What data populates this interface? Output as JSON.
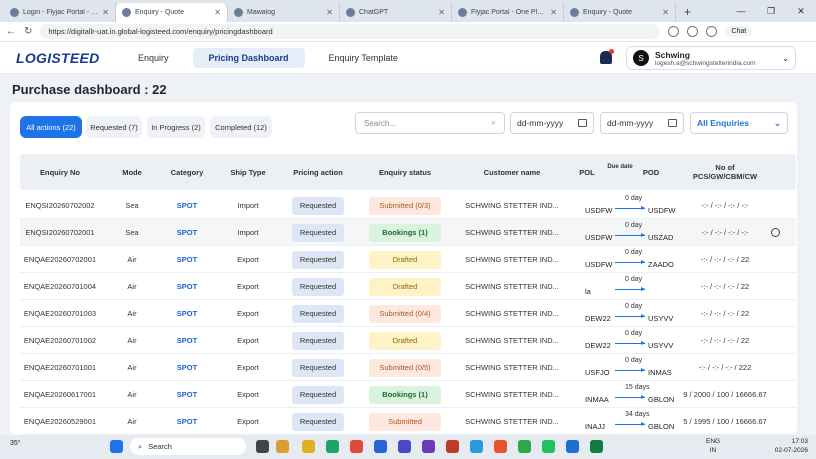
{
  "browser": {
    "tabs": [
      {
        "title": "Login - Flyjac Portal - One Pl",
        "active": false
      },
      {
        "title": "Enquiry - Quote",
        "active": true
      },
      {
        "title": "Mawalog",
        "active": false
      },
      {
        "title": "ChatGPT",
        "active": false
      },
      {
        "title": "Flyjac Portal - One Place for",
        "active": false
      },
      {
        "title": "Enquiry - Quote",
        "active": false
      }
    ],
    "url": "https://digitallr-uat.in.global-logisteed.com/enquiry/pricingdashboard",
    "chat_label": "Chat"
  },
  "header": {
    "logo": "LOGISTEED",
    "nav": [
      {
        "label": "Enquiry",
        "active": false
      },
      {
        "label": "Pricing Dashboard",
        "active": true
      },
      {
        "label": "Enquiry Template",
        "active": false
      }
    ],
    "user": {
      "initial": "S",
      "name": "Schwing",
      "email": "logesh.a@schwingstetterindia.com"
    }
  },
  "page": {
    "title": "Purchase dashboard : 22"
  },
  "filters": {
    "chips": [
      {
        "label": "All actions (22)",
        "active": true
      },
      {
        "label": "Requested (7)",
        "active": false
      },
      {
        "label": "In Progress (2)",
        "active": false
      },
      {
        "label": "Completed (12)",
        "active": false
      }
    ],
    "search_placeholder": "Search...",
    "date_from": "dd-mm-yyyy",
    "date_to": "dd-mm-yyyy",
    "enquiry_select": "All Enquiries"
  },
  "table": {
    "headers": {
      "enquiry_no": "Enquiry No",
      "mode": "Mode",
      "category": "Category",
      "ship_type": "Ship Type",
      "pricing_action": "Pricing action",
      "enquiry_status": "Enquiry status",
      "customer_name": "Customer name",
      "pol": "POL",
      "due_date": "Due date",
      "pod": "POD",
      "pieces_line1": "No of",
      "pieces_line2": "PCS/GW/CBM/CW"
    },
    "rows": [
      {
        "enq": "ENQSI20260702002",
        "mode": "Sea",
        "cat": "SPOT",
        "ship": "Import",
        "action": "Requested",
        "status": "Submitted (0/3)",
        "status_kind": "sub",
        "customer": "SCHWING STETTER IND...",
        "pol": "USDFW",
        "due": "0 day",
        "pod": "USDFW",
        "pcs": "-:- / -:- / -:- / -:-"
      },
      {
        "enq": "ENQSI20260702001",
        "mode": "Sea",
        "cat": "SPOT",
        "ship": "Import",
        "action": "Requested",
        "status": "Bookings (1)",
        "status_kind": "book",
        "customer": "SCHWING STETTER IND...",
        "pol": "USDFW",
        "due": "0 day",
        "pod": "USZAD",
        "pcs": "-:- / -:- / -:- / -:-"
      },
      {
        "enq": "ENQAE20260702001",
        "mode": "Air",
        "cat": "SPOT",
        "ship": "Export",
        "action": "Requested",
        "status": "Drafted",
        "status_kind": "draft",
        "customer": "SCHWING STETTER IND...",
        "pol": "USDFW",
        "due": "0 day",
        "pod": "ZAADO",
        "pcs": "-:- / -:- / -:- / 22"
      },
      {
        "enq": "ENQAE20260701004",
        "mode": "Air",
        "cat": "SPOT",
        "ship": "Export",
        "action": "Requested",
        "status": "Drafted",
        "status_kind": "draft",
        "customer": "SCHWING STETTER IND...",
        "pol": "la",
        "due": "0 day",
        "pod": "",
        "pcs": "-:- / -:- / -:- / 22"
      },
      {
        "enq": "ENQAE20260701003",
        "mode": "Air",
        "cat": "SPOT",
        "ship": "Export",
        "action": "Requested",
        "status": "Submitted (0/4)",
        "status_kind": "sub",
        "customer": "SCHWING STETTER IND...",
        "pol": "DEW22",
        "due": "0 day",
        "pod": "USYVV",
        "pcs": "-:- / -:- / -:- / 22"
      },
      {
        "enq": "ENQAE20260701002",
        "mode": "Air",
        "cat": "SPOT",
        "ship": "Export",
        "action": "Requested",
        "status": "Drafted",
        "status_kind": "draft",
        "customer": "SCHWING STETTER IND...",
        "pol": "DEW22",
        "due": "0 day",
        "pod": "USYVV",
        "pcs": "-:- / -:- / -:- / 22"
      },
      {
        "enq": "ENQAE20260701001",
        "mode": "Air",
        "cat": "SPOT",
        "ship": "Export",
        "action": "Requested",
        "status": "Submitted (0/5)",
        "status_kind": "sub",
        "customer": "SCHWING STETTER IND...",
        "pol": "USFJO",
        "due": "0 day",
        "pod": "INMAS",
        "pcs": "-:- / -:- / -:- / 222"
      },
      {
        "enq": "ENQAE20260617001",
        "mode": "Air",
        "cat": "SPOT",
        "ship": "Export",
        "action": "Requested",
        "status": "Bookings (1)",
        "status_kind": "book",
        "customer": "SCHWING STETTER IND...",
        "pol": "INMAA",
        "due": "15 days",
        "pod": "GBLON",
        "pcs": "9 / 2000 / 100 / 16666.67"
      },
      {
        "enq": "ENQAE20260529001",
        "mode": "Air",
        "cat": "SPOT",
        "ship": "Export",
        "action": "Requested",
        "status": "Submitted",
        "status_kind": "sub",
        "customer": "SCHWING STETTER IND...",
        "pol": "INAJJ",
        "due": "34 days",
        "pod": "GBLON",
        "pcs": "5 / 1995 / 100 / 16666.67"
      }
    ]
  },
  "taskbar": {
    "weather": "35°",
    "search": "Search",
    "lang1": "ENG",
    "lang2": "IN",
    "time": "17:03",
    "date": "02-07-2026"
  }
}
